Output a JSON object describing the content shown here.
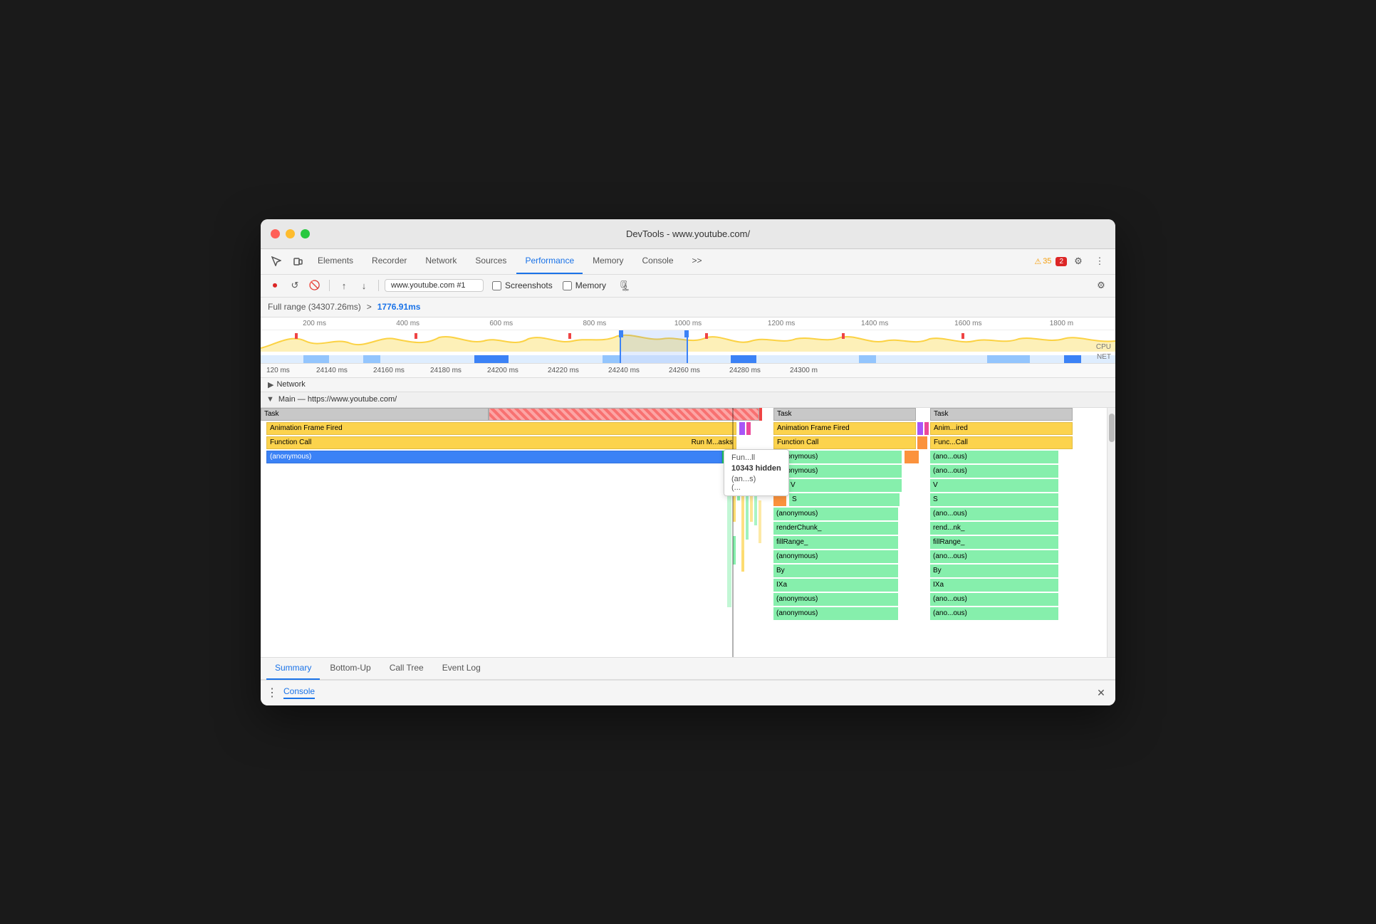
{
  "window": {
    "title": "DevTools - www.youtube.com/"
  },
  "nav": {
    "tabs": [
      {
        "label": "Elements",
        "active": false
      },
      {
        "label": "Recorder",
        "active": false
      },
      {
        "label": "Network",
        "active": false
      },
      {
        "label": "Sources",
        "active": false
      },
      {
        "label": "Performance",
        "active": true
      },
      {
        "label": "Memory",
        "active": false
      },
      {
        "label": "Console",
        "active": false
      }
    ],
    "more_tabs": ">>",
    "warn_count": "35",
    "error_count": "2"
  },
  "toolbar": {
    "url": "www.youtube.com #1",
    "screenshots_label": "Screenshots",
    "memory_label": "Memory"
  },
  "range": {
    "full_label": "Full range (34307.26ms)",
    "arrow": ">",
    "selected": "1776.91ms"
  },
  "ruler_top": {
    "marks": [
      "200 ms",
      "400 ms",
      "600 ms",
      "800 ms",
      "1000 ms",
      "1200 ms",
      "1400 ms",
      "1600 ms",
      "1800 m"
    ]
  },
  "labels": {
    "cpu": "CPU",
    "net": "NET"
  },
  "ruler_bottom": {
    "marks": [
      "120 ms",
      "24140 ms",
      "24160 ms",
      "24180 ms",
      "24200 ms",
      "24220 ms",
      "24240 ms",
      "24260 ms",
      "24280 ms",
      "24300 m"
    ]
  },
  "sections": {
    "network": "Network",
    "main": "Main — https://www.youtube.com/"
  },
  "flame": {
    "rows": [
      {
        "label": "Task",
        "type": "task",
        "color": "gray"
      },
      {
        "label": "Animation Frame Fired",
        "color": "yellow"
      },
      {
        "label": "Function Call",
        "color": "yellow"
      },
      {
        "label": "(anonymous)",
        "color": "blue-selected"
      }
    ],
    "tooltip": {
      "top_label": "Fun...ll",
      "hidden_text": "10343 hidden",
      "bottom_label": "(an...s)",
      "sub_label": "(..."
    },
    "right_column": {
      "task": "Task",
      "animation": "Animation Frame Fired",
      "function": "Function Call",
      "rows": [
        "(anonymous)",
        "(anonymous)",
        "(...  V",
        "S",
        "(anonymous)",
        "renderChunk_",
        "fillRange_",
        "(anonymous)",
        "By",
        "IXa",
        "(anonymous)",
        "(anonymous)"
      ]
    },
    "far_right_column": {
      "task": "Task",
      "animation": "Anim...ired",
      "function": "Func...Call",
      "rows": [
        "(ano...ous)",
        "(ano...ous)",
        "V",
        "S",
        "(ano...ous)",
        "rend...nk_",
        "fillRange_",
        "(ano...ous)",
        "By",
        "IXa",
        "(ano...ous)",
        "(ano...ous)"
      ]
    }
  },
  "bottom_tabs": [
    {
      "label": "Summary",
      "active": true
    },
    {
      "label": "Bottom-Up",
      "active": false
    },
    {
      "label": "Call Tree",
      "active": false
    },
    {
      "label": "Event Log",
      "active": false
    }
  ],
  "console": {
    "label": "Console",
    "close": "×"
  }
}
